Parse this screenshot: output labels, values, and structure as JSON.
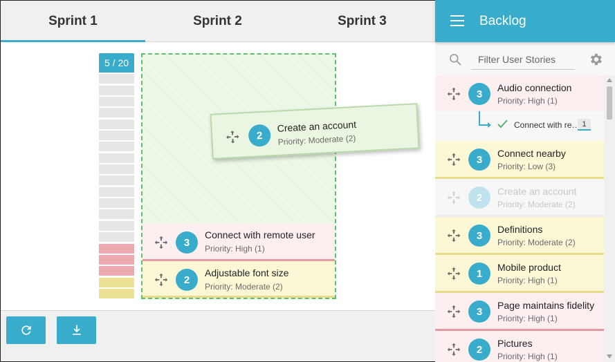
{
  "sprints": {
    "tabs": [
      {
        "label": "Sprint 1",
        "active": true
      },
      {
        "label": "Sprint 2",
        "active": false
      },
      {
        "label": "Sprint 3",
        "active": false
      }
    ],
    "capacity": {
      "label": "5 / 20",
      "used": 5,
      "total": 20
    },
    "dragging_card": {
      "points": "2",
      "title": "Create an account",
      "priority": "Priority: Moderate (2)"
    },
    "stories": [
      {
        "points": "3",
        "title": "Connect with remote user",
        "priority": "Priority: High (1)",
        "level": "high"
      },
      {
        "points": "2",
        "title": "Adjustable font size",
        "priority": "Priority: Moderate (2)",
        "level": "mod"
      }
    ]
  },
  "footer": {
    "refresh_icon": "refresh-icon",
    "download_icon": "download-icon"
  },
  "backlog": {
    "title": "Backlog",
    "filter_placeholder": "Filter User Stories",
    "items": [
      {
        "points": "3",
        "title": "Audio connection",
        "priority": "Priority: High (1)",
        "level": "high"
      },
      {
        "points": "3",
        "title": "Connect nearby",
        "priority": "Priority: Low (3)",
        "level": "low"
      },
      {
        "points": "2",
        "title": "Create an account",
        "priority": "Priority: Moderate (2)",
        "level": "ghost"
      },
      {
        "points": "3",
        "title": "Definitions",
        "priority": "Priority: Moderate (2)",
        "level": "mod"
      },
      {
        "points": "1",
        "title": "Mobile product",
        "priority": "Priority: High (1)",
        "level": "mod"
      },
      {
        "points": "3",
        "title": "Page maintains fidelity",
        "priority": "Priority: High (1)",
        "level": "high"
      },
      {
        "points": "2",
        "title": "Pictures",
        "priority": "Priority: High (1)",
        "level": "high"
      }
    ],
    "subtask": {
      "label": "Connect with re…",
      "count": "1"
    }
  },
  "colors": {
    "accent": "#3aaccb",
    "high": "#e59aa1",
    "moderate": "#e8dc8a",
    "drop_zone": "#5ec06a"
  }
}
